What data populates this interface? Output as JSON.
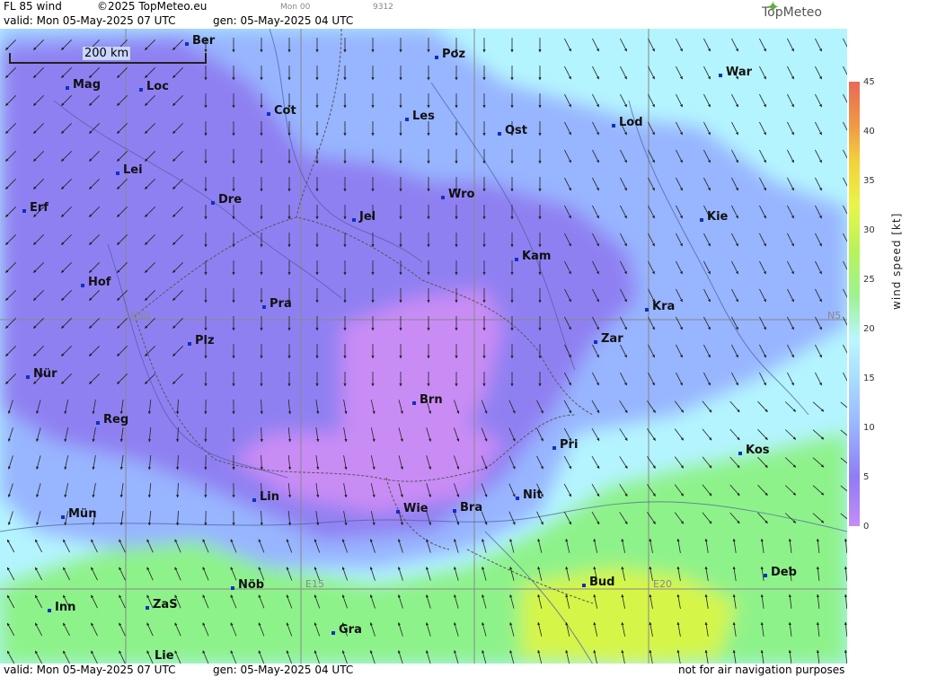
{
  "header": {
    "product": "FL 85 wind",
    "copyright": "©2025 TopMeteo.eu",
    "run_tag": "Mon 00",
    "code": "9312",
    "valid": "valid:  Mon  05-May-2025  07 UTC",
    "gen": "gen: 05-May-2025 04 UTC",
    "brand": "TopMeteo"
  },
  "footer": {
    "valid": "valid:  Mon  05-May-2025  07 UTC",
    "gen": "gen: 05-May-2025 04 UTC",
    "disclaimer": "not for air navigation purposes"
  },
  "map": {
    "scale_label": "200 km",
    "grid_labels": {
      "n50_left": "N50",
      "n50_right": "N5",
      "e15": "E15",
      "e20": "E20"
    },
    "cities": [
      "Ber",
      "Poz",
      "War",
      "Mag",
      "Loc",
      "Cot",
      "Les",
      "Lod",
      "Ost",
      "Lei",
      "Wro",
      "Erf",
      "Dre",
      "Jel",
      "Kie",
      "Kam",
      "Hof",
      "Pra",
      "Kra",
      "Plz",
      "Zar",
      "Nür",
      "Brn",
      "Reg",
      "Pri",
      "Kos",
      "Lin",
      "Nit",
      "Wie",
      "Bra",
      "Mün",
      "Nöb",
      "Bud",
      "Deb",
      "Inn",
      "ZaS",
      "Gra",
      "Lie"
    ],
    "colors": {
      "calm": "#c98cf5",
      "light": "#8f80f2",
      "moderate": "#98b5ff",
      "fresh": "#b4f4ff",
      "strong": "#8ef28a",
      "stronger": "#d6f54a"
    }
  },
  "legend": {
    "title": "wind speed [kt]",
    "ticks": [
      "45",
      "40",
      "35",
      "30",
      "25",
      "20",
      "15",
      "10",
      "5",
      "0"
    ]
  }
}
